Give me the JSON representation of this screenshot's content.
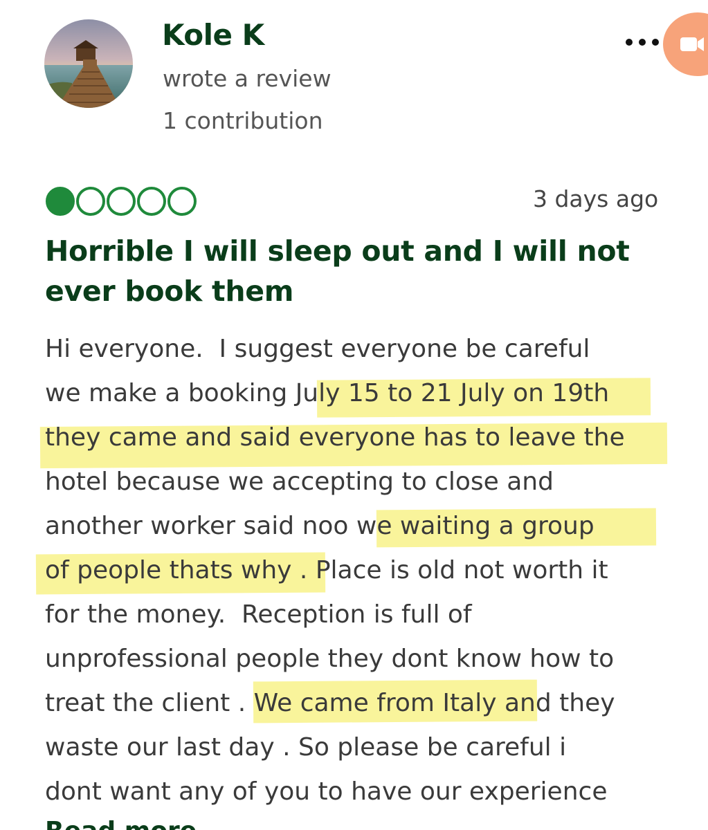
{
  "reviewer": {
    "name": "Kole K",
    "action": "wrote a review",
    "contributions": "1 contribution",
    "avatar_icon": "pier-sunset-avatar"
  },
  "header_actions": {
    "more_icon": "more-horizontal-icon",
    "video_icon": "video-camera-icon",
    "video_button_color": "#f7a37a"
  },
  "review": {
    "rating": 1,
    "rating_max": 5,
    "rating_color": "#1f8a3b",
    "date": "3 days ago",
    "title": "Horrible I will sleep out and I will not ever book them",
    "body_lines": [
      "Hi everyone.  I suggest everyone be careful",
      "we make a booking July 15 to 21 July on 19th",
      "they came and said everyone has to leave the",
      "hotel because we accepting to close and",
      "another worker said noo we waiting a group",
      "of people thats why . Place is old not worth it",
      "for the money.  Reception is full of",
      "unprofessional people they dont know how to",
      "treat the client . We came from Italy and they",
      "waste our last day . So please be careful i",
      "dont want any of you to have our experience"
    ],
    "highlight_color": "#f8f28a",
    "next_link_partial": "Read more"
  }
}
